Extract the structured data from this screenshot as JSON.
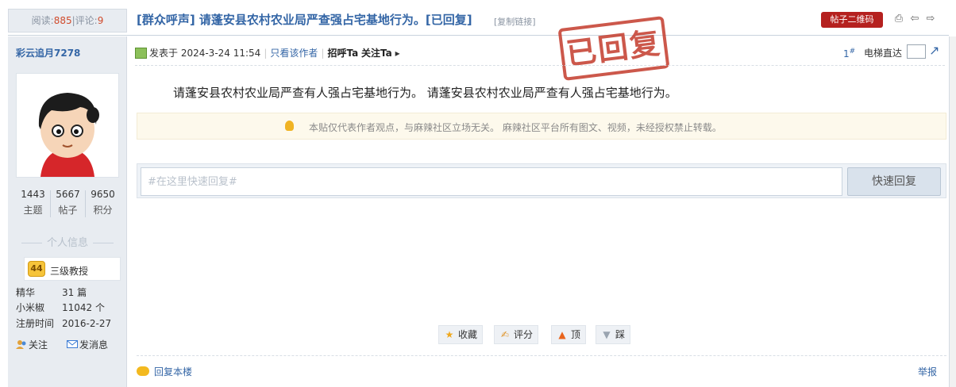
{
  "stats": {
    "views_label": "阅读:",
    "views": "885",
    "sep": "|",
    "comments_label": "评论:",
    "comments": "9"
  },
  "thread": {
    "title": "[群众呼声] 请蓬安县农村农业局严查强占宅基地行为。[已回复]",
    "copy_link": "[复制链接]",
    "qr_label": "帖子二维码",
    "stamp_text": "已回复"
  },
  "author": {
    "name": "彩云追月7278",
    "threads": "1443",
    "threads_label": "主题",
    "posts": "5667",
    "posts_label": "帖子",
    "points": "9650",
    "points_label": "积分",
    "info_title": "个人信息",
    "rank_level": "44",
    "rank_name": "三级教授",
    "meta": [
      {
        "k": "精华",
        "v": "31 篇"
      },
      {
        "k": "小米椒",
        "v": "11042 个"
      },
      {
        "k": "注册时间",
        "v": "2016-2-27"
      }
    ],
    "follow": "关注",
    "message": "发消息"
  },
  "post": {
    "posted_at": "发表于 2024-3-24 11:54",
    "only_author": "只看该作者",
    "greet": "招呼Ta",
    "follow_ta": "关注Ta",
    "floor_num": "1",
    "floor_suffix": "#",
    "elevator_label": "电梯直达",
    "content": "请蓬安县农村农业局严查有人强占宅基地行为。 请蓬安县农村农业局严查有人强占宅基地行为。",
    "notice": "本贴仅代表作者观点，与麻辣社区立场无关。 麻辣社区平台所有图文、视频，未经授权禁止转载。",
    "reply_placeholder": "#在这里快速回复#",
    "reply_button": "快速回复",
    "actions": [
      {
        "label": "收藏",
        "icon": "star-icon"
      },
      {
        "label": "评分",
        "icon": "rate-icon"
      },
      {
        "label": "顶",
        "icon": "up-arrow-icon"
      },
      {
        "label": "踩",
        "icon": "down-arrow-icon"
      }
    ],
    "reply_floor": "回复本楼",
    "report": "举报"
  },
  "colors": {
    "link": "#3466a6",
    "accent_red": "#b5211f",
    "stamp": "#c43b2c",
    "sidebar_bg": "#e8ecf1"
  }
}
